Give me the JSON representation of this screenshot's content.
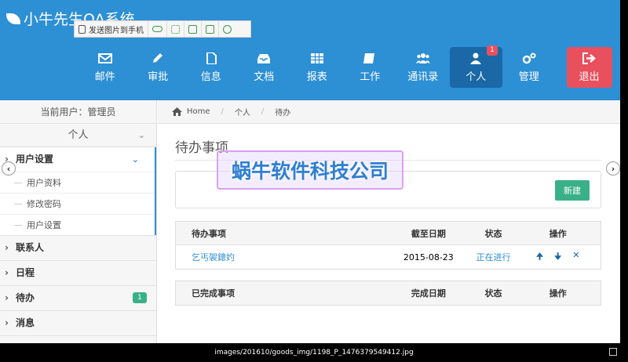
{
  "app": {
    "title": "小牛先生OA系统"
  },
  "float_bar": {
    "send_label": "发送图片到手机",
    "icons": [
      "cloud-icon",
      "expand-icon",
      "save-icon",
      "share-icon",
      "settings-icon"
    ]
  },
  "nav": {
    "items": [
      {
        "label": "邮件",
        "icon": "mail-icon"
      },
      {
        "label": "审批",
        "icon": "pencil-icon"
      },
      {
        "label": "信息",
        "icon": "document-icon"
      },
      {
        "label": "文档",
        "icon": "inbox-icon"
      },
      {
        "label": "报表",
        "icon": "table-icon"
      },
      {
        "label": "工作",
        "icon": "book-icon"
      },
      {
        "label": "通讯录",
        "icon": "users-icon"
      },
      {
        "label": "个人",
        "icon": "user-icon",
        "badge": "1",
        "active": true
      },
      {
        "label": "管理",
        "icon": "gears-icon"
      }
    ],
    "logout_label": "退出"
  },
  "sidebar": {
    "current_user": "当前用户：管理员",
    "section": "个人",
    "groups": [
      {
        "label": "用户设置",
        "open": true,
        "items": [
          "用户资料",
          "修改密码",
          "用户设置"
        ]
      },
      {
        "label": "联系人"
      },
      {
        "label": "日程"
      },
      {
        "label": "待办",
        "badge": "1"
      },
      {
        "label": "消息"
      }
    ]
  },
  "breadcrumb": {
    "home": "Home",
    "level1": "个人",
    "level2": "待办"
  },
  "main": {
    "title": "待办事项",
    "new_button": "新建",
    "todo_table": {
      "headers": [
        "待办事项",
        "截至日期",
        "状态",
        "操作"
      ],
      "rows": [
        {
          "item": "乞丐袈鏓妁",
          "date": "2015-08-23",
          "status": "正在进行"
        }
      ]
    },
    "done_table": {
      "headers": [
        "已完成事项",
        "完成日期",
        "状态",
        "操作"
      ]
    }
  },
  "watermark": "蜗牛软件科技公司",
  "footer": {
    "path": "images/201610/goods_img/1198_P_1476379549412.jpg"
  },
  "colors": {
    "header": "#2d8fd4",
    "active_nav": "#1a68a6",
    "logout": "#e9505e",
    "accent_green": "#3ab089"
  }
}
